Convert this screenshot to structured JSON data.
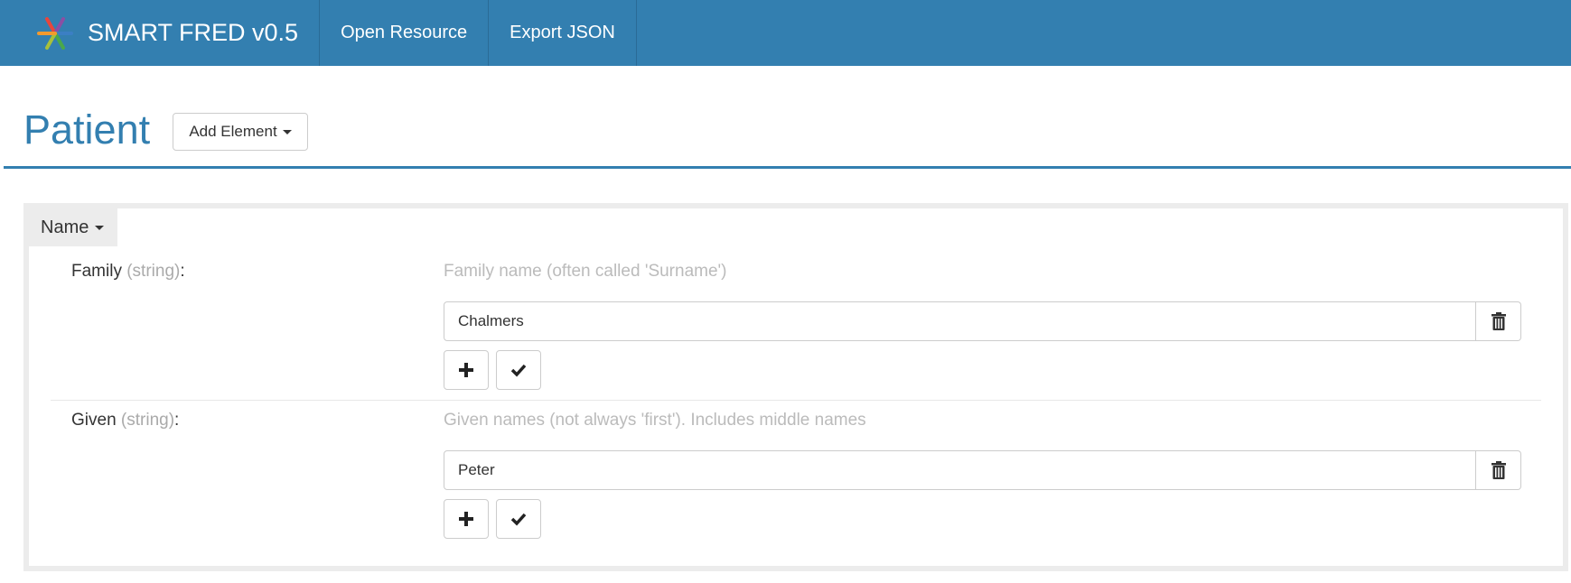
{
  "nav": {
    "brand": "SMART FRED v0.5",
    "items": [
      "Open Resource",
      "Export JSON"
    ]
  },
  "header": {
    "title": "Patient",
    "add_element_label": "Add Element"
  },
  "group": {
    "label": "Name",
    "fields": [
      {
        "name": "Family",
        "type": "(string)",
        "colon": ":",
        "description": "Family name (often called 'Surname')",
        "value": "Chalmers"
      },
      {
        "name": "Given",
        "type": "(string)",
        "colon": ":",
        "description": "Given names (not always 'first'). Includes middle names",
        "value": "Peter"
      }
    ]
  },
  "icons": {
    "brand_logo": "smart-logo-icon",
    "delete": "trash-icon",
    "add": "plus-icon",
    "confirm": "check-icon",
    "dropdown": "caret-down-icon"
  },
  "colors": {
    "navbar": "#337fb0",
    "title": "#337fb0",
    "panel_border": "#ececec",
    "type_text": "#aaaaaa",
    "description_text": "#bbbbbb"
  }
}
